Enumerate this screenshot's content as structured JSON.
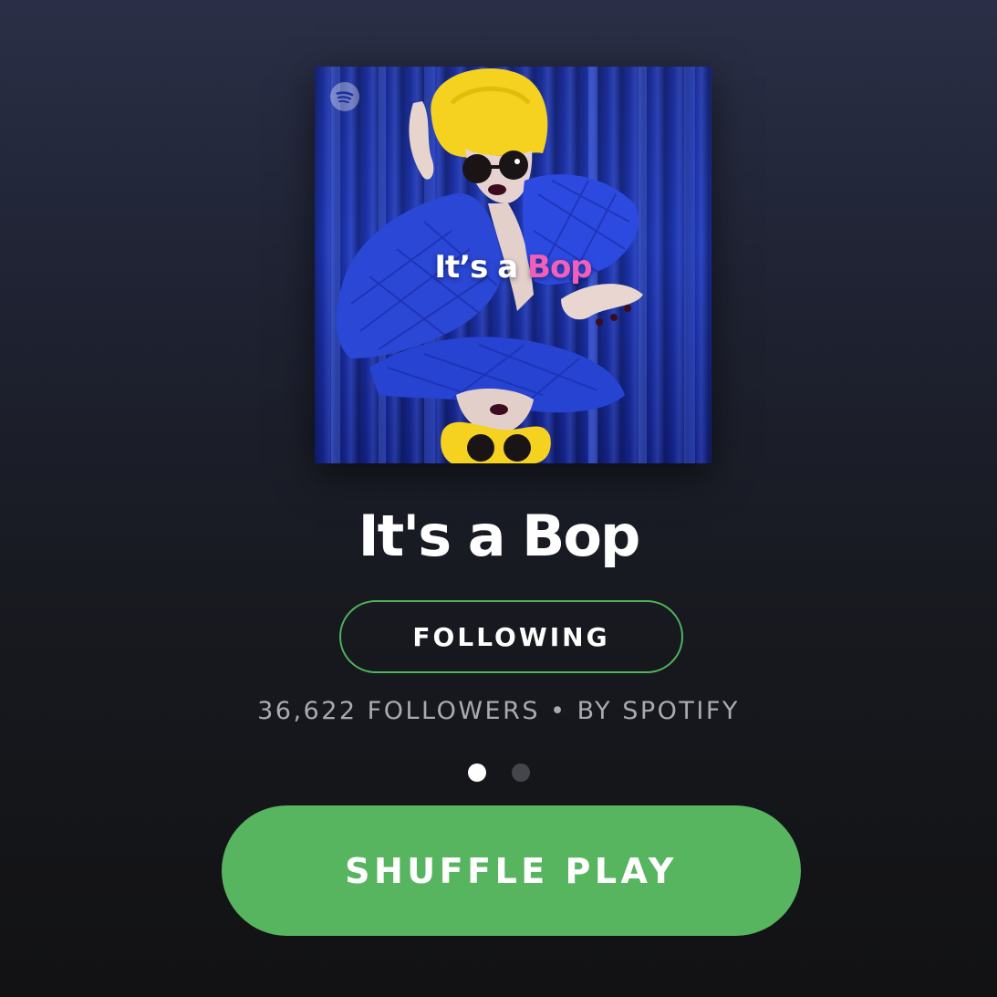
{
  "playlist": {
    "cover": {
      "title_main": "It’s a ",
      "title_accent": "Bop",
      "accent_color": "#f25fba",
      "logo_icon": "spotify-logo-icon"
    },
    "title": "It's a Bop",
    "follow_button_label": "FOLLOWING",
    "followers": "36,622 FOLLOWERS",
    "separator": "•",
    "owner": "BY SPOTIFY"
  },
  "pager": {
    "total": 2,
    "active_index": 0
  },
  "shuffle_button_label": "SHUFFLE PLAY",
  "colors": {
    "accent_green": "#57b560",
    "follow_border": "#4fb55c",
    "meta_text": "#a9abb2"
  }
}
